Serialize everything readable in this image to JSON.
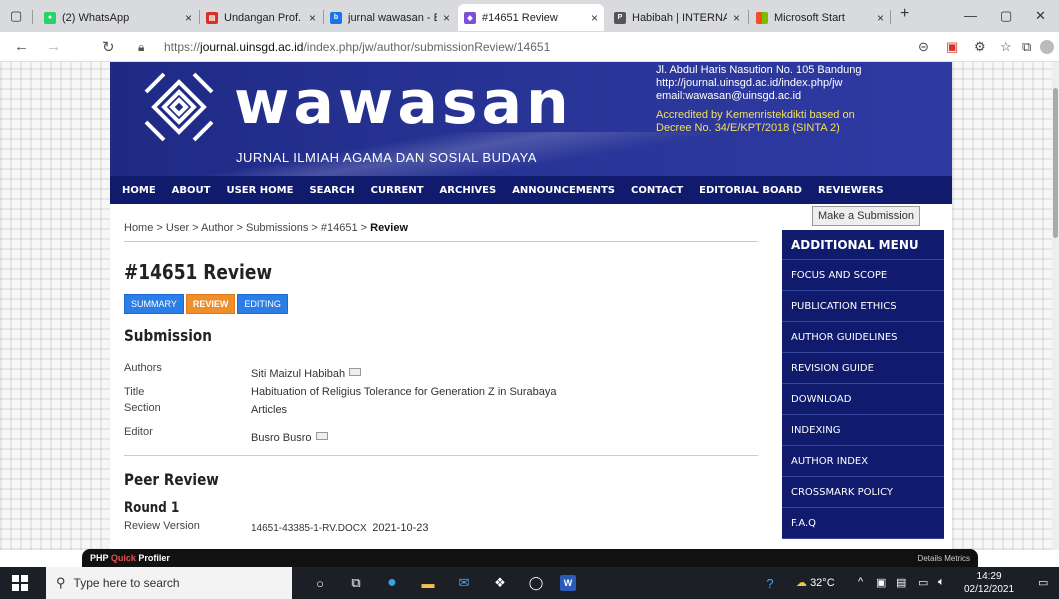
{
  "browser": {
    "tabs": [
      {
        "label": "(2) WhatsApp",
        "color": "#25d366"
      },
      {
        "label": "Undangan Prof. Az",
        "color": "#d93025"
      },
      {
        "label": "jurnal wawasan - B",
        "color": "#1a73e8"
      },
      {
        "label": "#14651 Review",
        "color": "#7b4fd6"
      },
      {
        "label": "Habibah | INTERNA",
        "color": "#555555"
      },
      {
        "label": "Microsoft Start",
        "color": "#f25022"
      }
    ],
    "url_prefix": "https://",
    "url_domain": "journal.uinsgd.ac.id",
    "url_path": "/index.php/jw/author/submissionReview/14651"
  },
  "banner": {
    "logo_text": "wawasan",
    "subtitle": "JURNAL ILMIAH AGAMA DAN SOSIAL BUDAYA",
    "address": "Jl. Abdul Haris Nasution No. 105 Bandung",
    "website": "http://journal.uinsgd.ac.id/index.php/jw",
    "email": "email:wawasan@uinsgd.ac.id",
    "accreditation_1": "Accredited by Kemenristekdikti based on",
    "accreditation_2": "Decree No. 34/E/KPT/2018 (SINTA 2)"
  },
  "menu": [
    "HOME",
    "ABOUT",
    "USER HOME",
    "SEARCH",
    "CURRENT",
    "ARCHIVES",
    "ANNOUNCEMENTS",
    "CONTACT",
    "EDITORIAL BOARD",
    "REVIEWERS"
  ],
  "breadcrumb": {
    "trail": "Home > User > Author > Submissions > #14651 > ",
    "current": "Review"
  },
  "page_title": "#14651 Review",
  "subtabs": [
    "SUMMARY",
    "REVIEW",
    "EDITING"
  ],
  "submission": {
    "heading": "Submission",
    "authors_label": "Authors",
    "authors": "Siti Maizul Habibah",
    "title_label": "Title",
    "title": "Habituation of Religius Tolerance for Generation Z in Surabaya",
    "section_label": "Section",
    "section": "Articles",
    "editor_label": "Editor",
    "editor": "Busro Busro"
  },
  "peer_review": {
    "heading": "Peer Review",
    "round": "Round 1",
    "version_label": "Review Version",
    "version_file": "14651-43385-1-RV.DOCX",
    "version_date": "2021-10-23"
  },
  "sidebar": {
    "make_submission": "Make a Submission",
    "heading": "ADDITIONAL MENU",
    "items": [
      "FOCUS AND SCOPE",
      "PUBLICATION ETHICS",
      "AUTHOR GUIDELINES",
      "REVISION GUIDE",
      "DOWNLOAD",
      "INDEXING",
      "AUTHOR INDEX",
      "CROSSMARK POLICY",
      "F.A.Q"
    ]
  },
  "profiler": {
    "label_a": "PHP ",
    "label_b": "Quick",
    "label_c": " Profiler",
    "right": "Details   Metrics"
  },
  "taskbar": {
    "search_placeholder": "Type here to search",
    "temperature": "32°C",
    "time": "14:29",
    "date": "02/12/2021"
  }
}
